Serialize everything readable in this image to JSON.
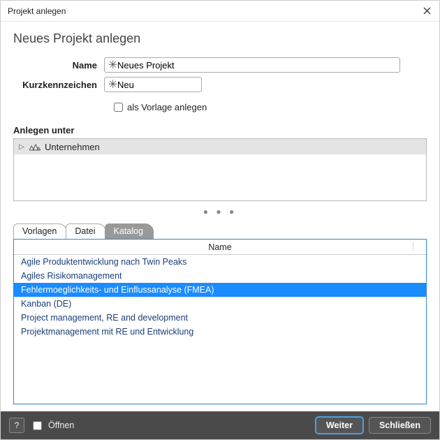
{
  "window": {
    "title": "Projekt anlegen"
  },
  "heading": "Neues Projekt anlegen",
  "form": {
    "name_label": "Name",
    "name_value": "Neues Projekt",
    "short_label": "Kurzkennzeichen",
    "short_value": "Neu",
    "template_checkbox_label": "als Vorlage anlegen"
  },
  "create_under": {
    "label": "Anlegen unter",
    "root": "Unternehmen"
  },
  "tabs": {
    "vorlagen": "Vorlagen",
    "datei": "Datei",
    "katalog": "Katalog"
  },
  "catalog": {
    "column_header": "Name",
    "items": [
      "Agile Produktentwicklung nach Twin Peaks",
      "Agiles Risikomanagement",
      "Fehlermoeglichkeits- und Einflussanalyse (FMEA)",
      "Kanban (DE)",
      "Project management, RE and development",
      "Projektmanagement mit RE und Entwicklung"
    ],
    "selected_index": 2
  },
  "footer": {
    "help": "?",
    "open_label": "Öffnen",
    "next": "Weiter",
    "close": "Schließen"
  }
}
